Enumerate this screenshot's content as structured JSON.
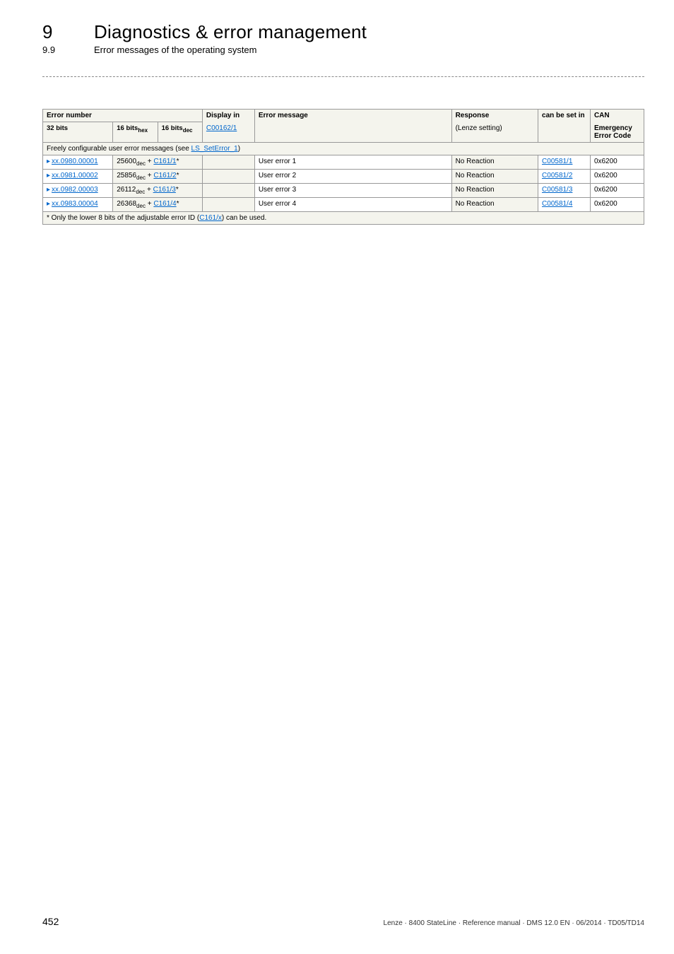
{
  "header": {
    "chapterNumber": "9",
    "chapterTitle": "Diagnostics & error management",
    "sectionNumber": "9.9",
    "sectionTitle": "Error messages of the operating system"
  },
  "table": {
    "headers": {
      "errorNumber": "Error number",
      "bits32": "32 bits",
      "bits16hex": "16 bits",
      "bits16hexSub": "hex",
      "bits16dec": "16 bits",
      "bits16decSub": "dec",
      "displayIn": "Display in",
      "displayLink": "C00162/1",
      "errorMessage": "Error message",
      "response": "Response",
      "responseSub": "(Lenze setting)",
      "canSetIn": "can be set in",
      "can": "CAN",
      "canEmergency": "Emergency",
      "canErrorCode": "Error Code"
    },
    "groupRow": {
      "textPrefix": "Freely configurable user error messages (see ",
      "linkText": "LS_SetError_1",
      "textSuffix": ")"
    },
    "rows": [
      {
        "id": "xx.0980.00001",
        "decVal": "25600",
        "decSub": "dec",
        "cLink": "C161/1",
        "msg": "User error 1",
        "response": "No Reaction",
        "setIn": "C00581/1",
        "canCode": "0x6200"
      },
      {
        "id": "xx.0981.00002",
        "decVal": "25856",
        "decSub": "dec",
        "cLink": "C161/2",
        "msg": "User error 2",
        "response": "No Reaction",
        "setIn": "C00581/2",
        "canCode": "0x6200"
      },
      {
        "id": "xx.0982.00003",
        "decVal": "26112",
        "decSub": "dec",
        "cLink": "C161/3",
        "msg": "User error 3",
        "response": "No Reaction",
        "setIn": "C00581/3",
        "canCode": "0x6200"
      },
      {
        "id": "xx.0983.00004",
        "decVal": "26368",
        "decSub": "dec",
        "cLink": "C161/4",
        "msg": "User error 4",
        "response": "No Reaction",
        "setIn": "C00581/4",
        "canCode": "0x6200"
      }
    ],
    "footnote": {
      "prefix": "* Only the lower 8 bits of the adjustable error ID (",
      "link": "C161/x",
      "suffix": ") can be used."
    }
  },
  "footer": {
    "pageNumber": "452",
    "text": "Lenze · 8400 StateLine · Reference manual · DMS 12.0 EN · 06/2014 · TD05/TD14"
  }
}
